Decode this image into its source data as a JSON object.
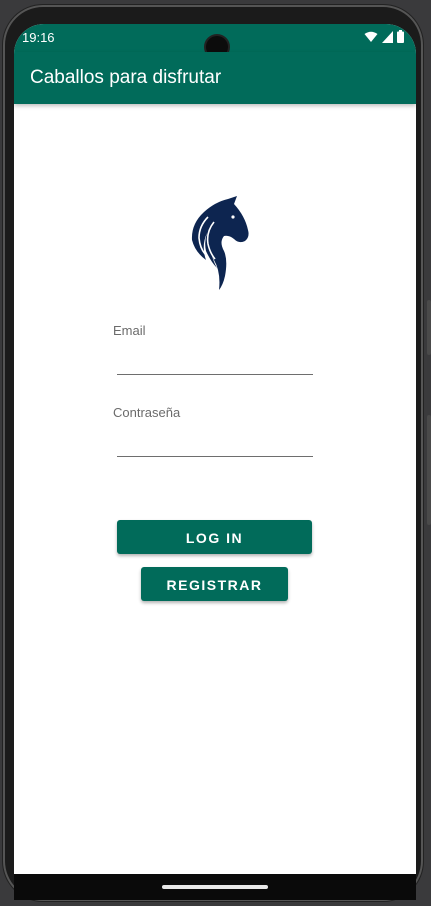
{
  "status_bar": {
    "time": "19:16"
  },
  "app_bar": {
    "title": "Caballos para disfrutar"
  },
  "form": {
    "email_label": "Email",
    "email_value": "",
    "password_label": "Contraseña",
    "password_value": ""
  },
  "buttons": {
    "login": "LOG IN",
    "register": "REGISTRAR"
  },
  "colors": {
    "primary": "#016b5a",
    "logo": "#0d2550"
  },
  "icons": {
    "logo": "horse-head-icon",
    "wifi": "wifi-icon",
    "signal": "signal-icon",
    "battery": "battery-icon"
  }
}
